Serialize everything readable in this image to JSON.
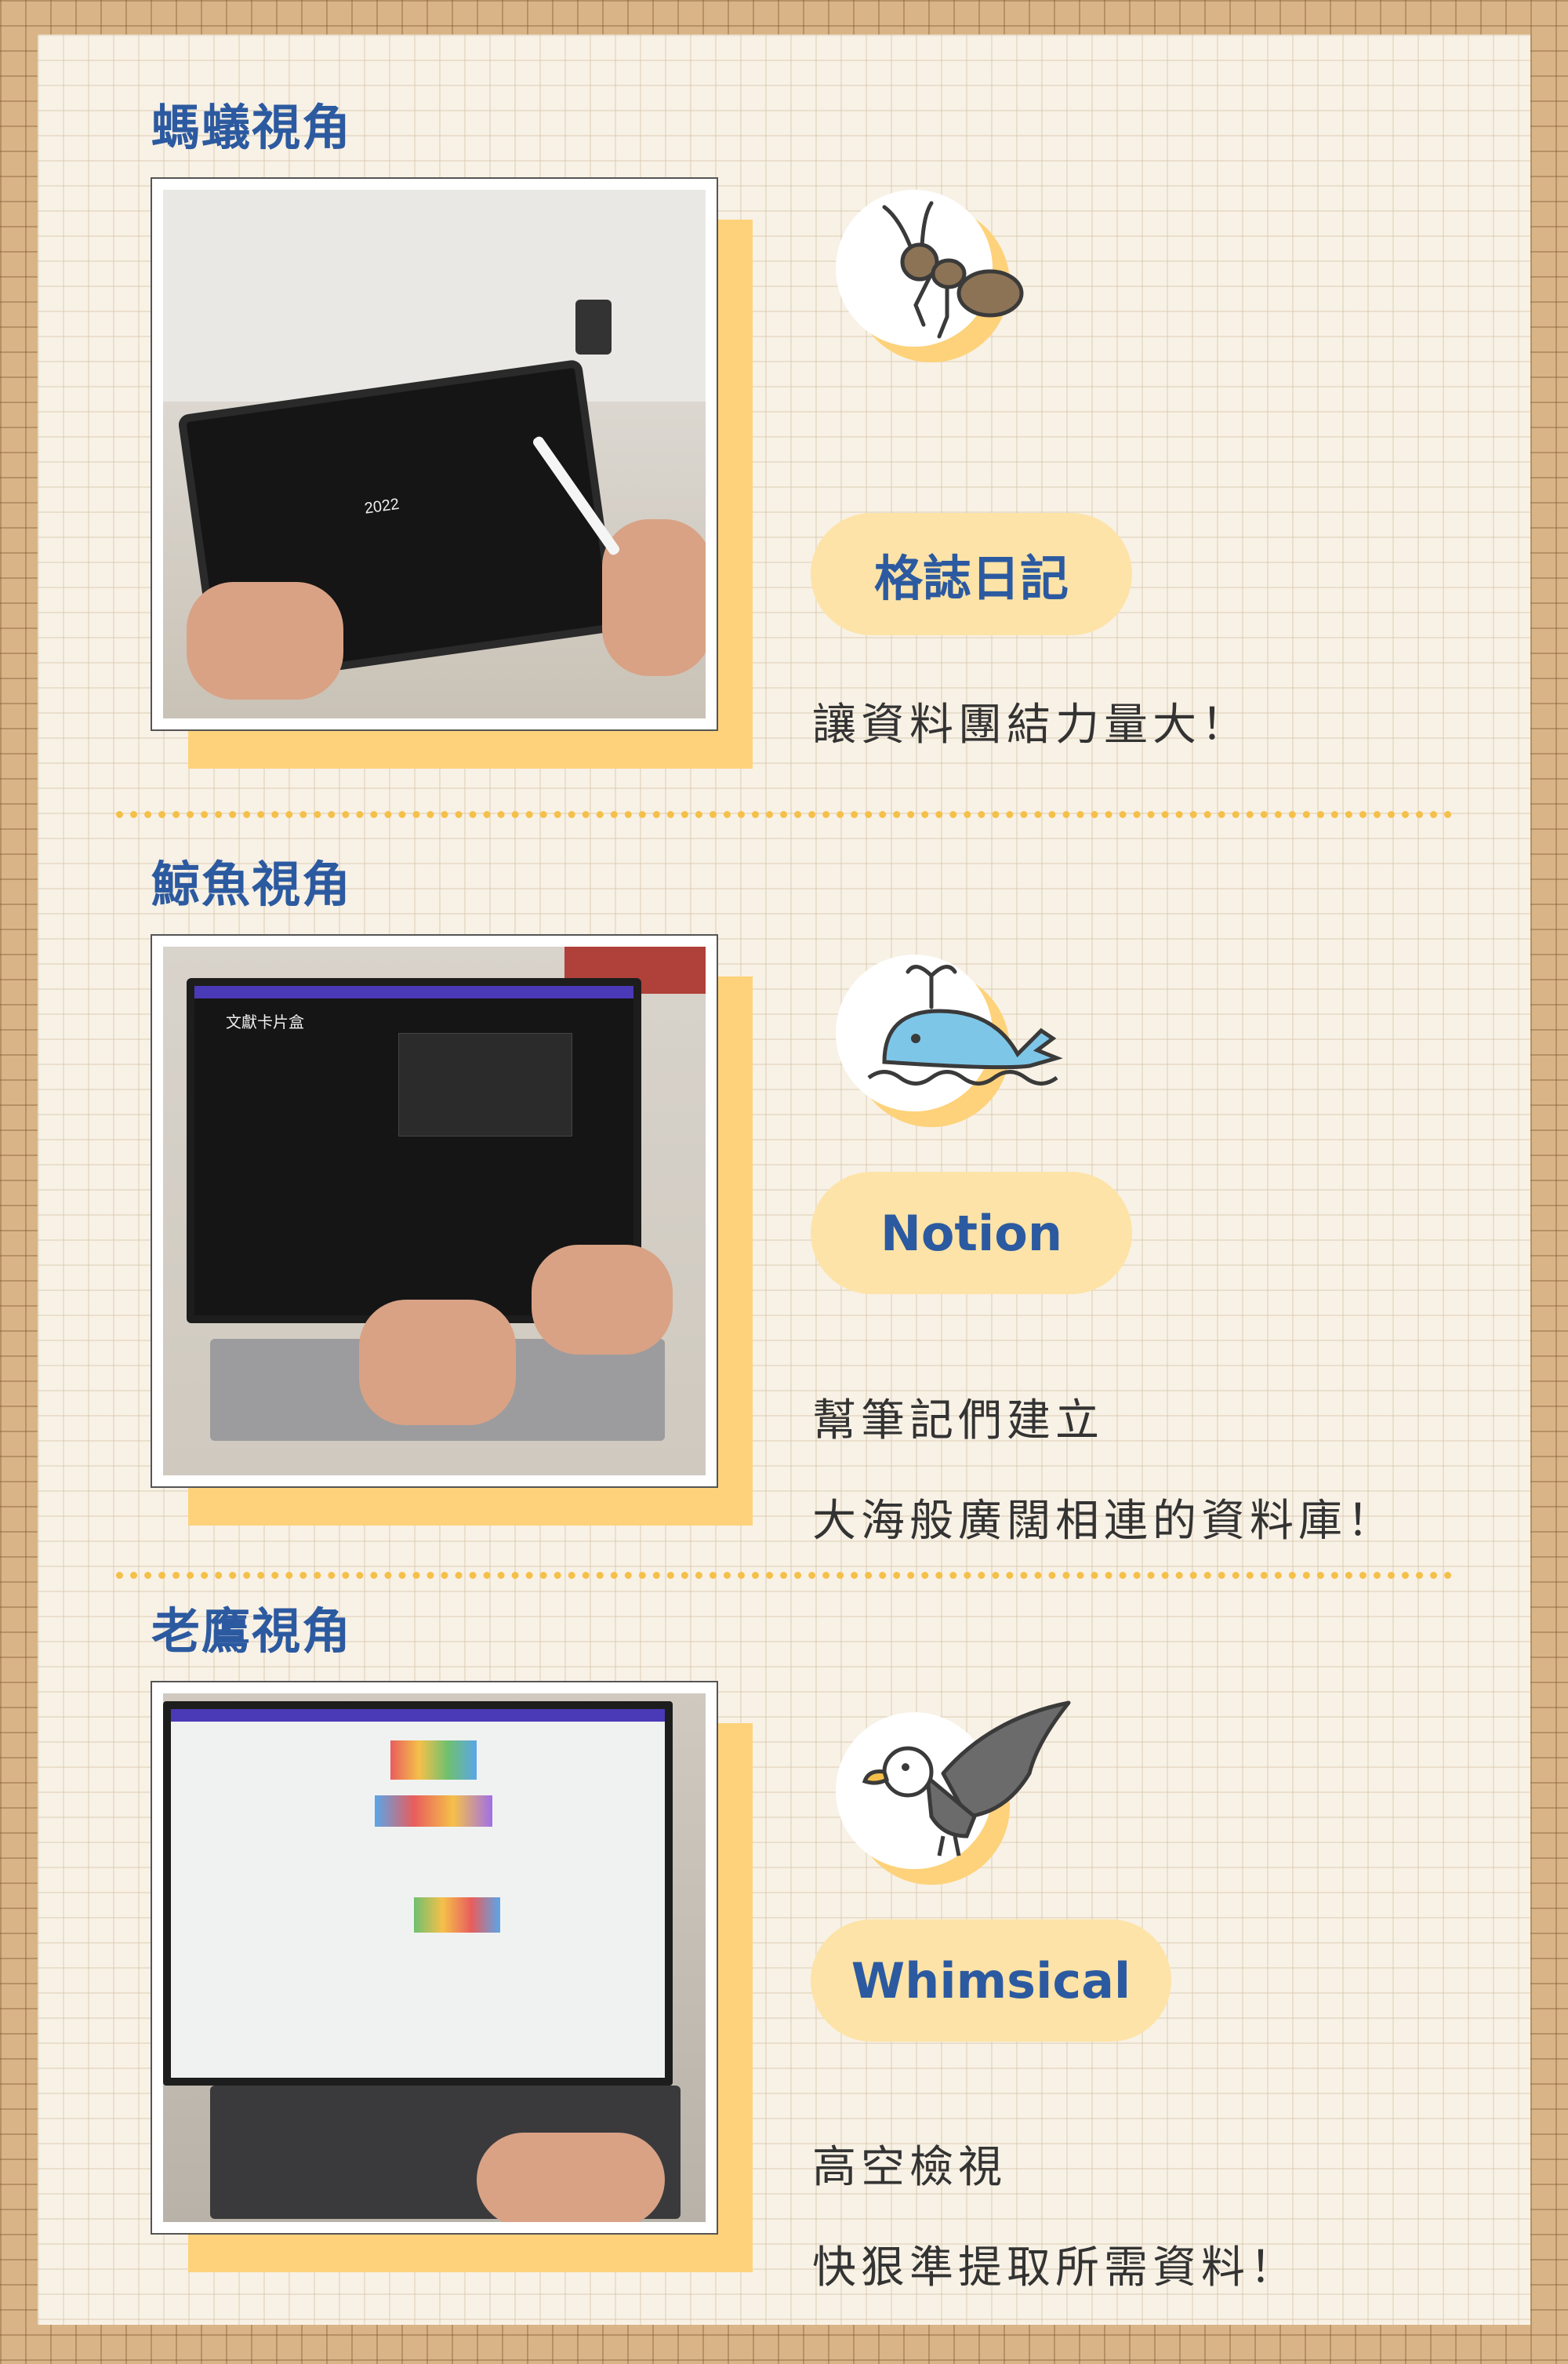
{
  "sections": [
    {
      "heading": "螞蟻視角",
      "icon": "ant-icon",
      "tool_name": "格誌日記",
      "desc_lines": [
        "讓資料團結力量大！"
      ],
      "screen_text": "2022"
    },
    {
      "heading": "鯨魚視角",
      "icon": "whale-icon",
      "tool_name": "Notion",
      "desc_lines": [
        "幫筆記們建立",
        "大海般廣闊相連的資料庫！"
      ],
      "screen_text": "文獻卡片盒"
    },
    {
      "heading": "老鷹視角",
      "icon": "eagle-icon",
      "tool_name": "Whimsical",
      "desc_lines": [
        "高空檢視",
        "快狠準提取所需資料！"
      ],
      "screen_text": ""
    }
  ],
  "colors": {
    "outer_bg": "#d9b487",
    "card_bg": "#f8f1e5",
    "heading_blue": "#2c5aa0",
    "accent_yellow": "#fdd27a",
    "pill_bg": "#fde3a7"
  }
}
